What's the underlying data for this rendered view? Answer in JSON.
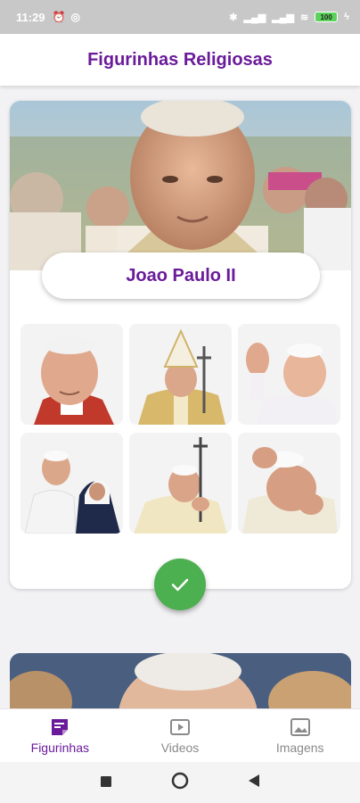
{
  "status_bar": {
    "time": "11:29",
    "battery": "100"
  },
  "app": {
    "title": "Figurinhas Religiosas"
  },
  "pack": {
    "name": "Joao Paulo II",
    "sticker_count": 6,
    "added": true
  },
  "bottom_nav": {
    "items": [
      {
        "label": "Figurinhas",
        "icon": "sticker-note-icon",
        "active": true
      },
      {
        "label": "Videos",
        "icon": "video-play-icon",
        "active": false
      },
      {
        "label": "Imagens",
        "icon": "image-icon",
        "active": false
      }
    ]
  },
  "colors": {
    "brand_purple": "#6a1b9a",
    "fab_green": "#4caf50",
    "inactive_gray": "#8a8a8a"
  },
  "system_nav": {
    "icons": [
      "recents-square-icon",
      "home-circle-icon",
      "back-triangle-icon"
    ]
  }
}
